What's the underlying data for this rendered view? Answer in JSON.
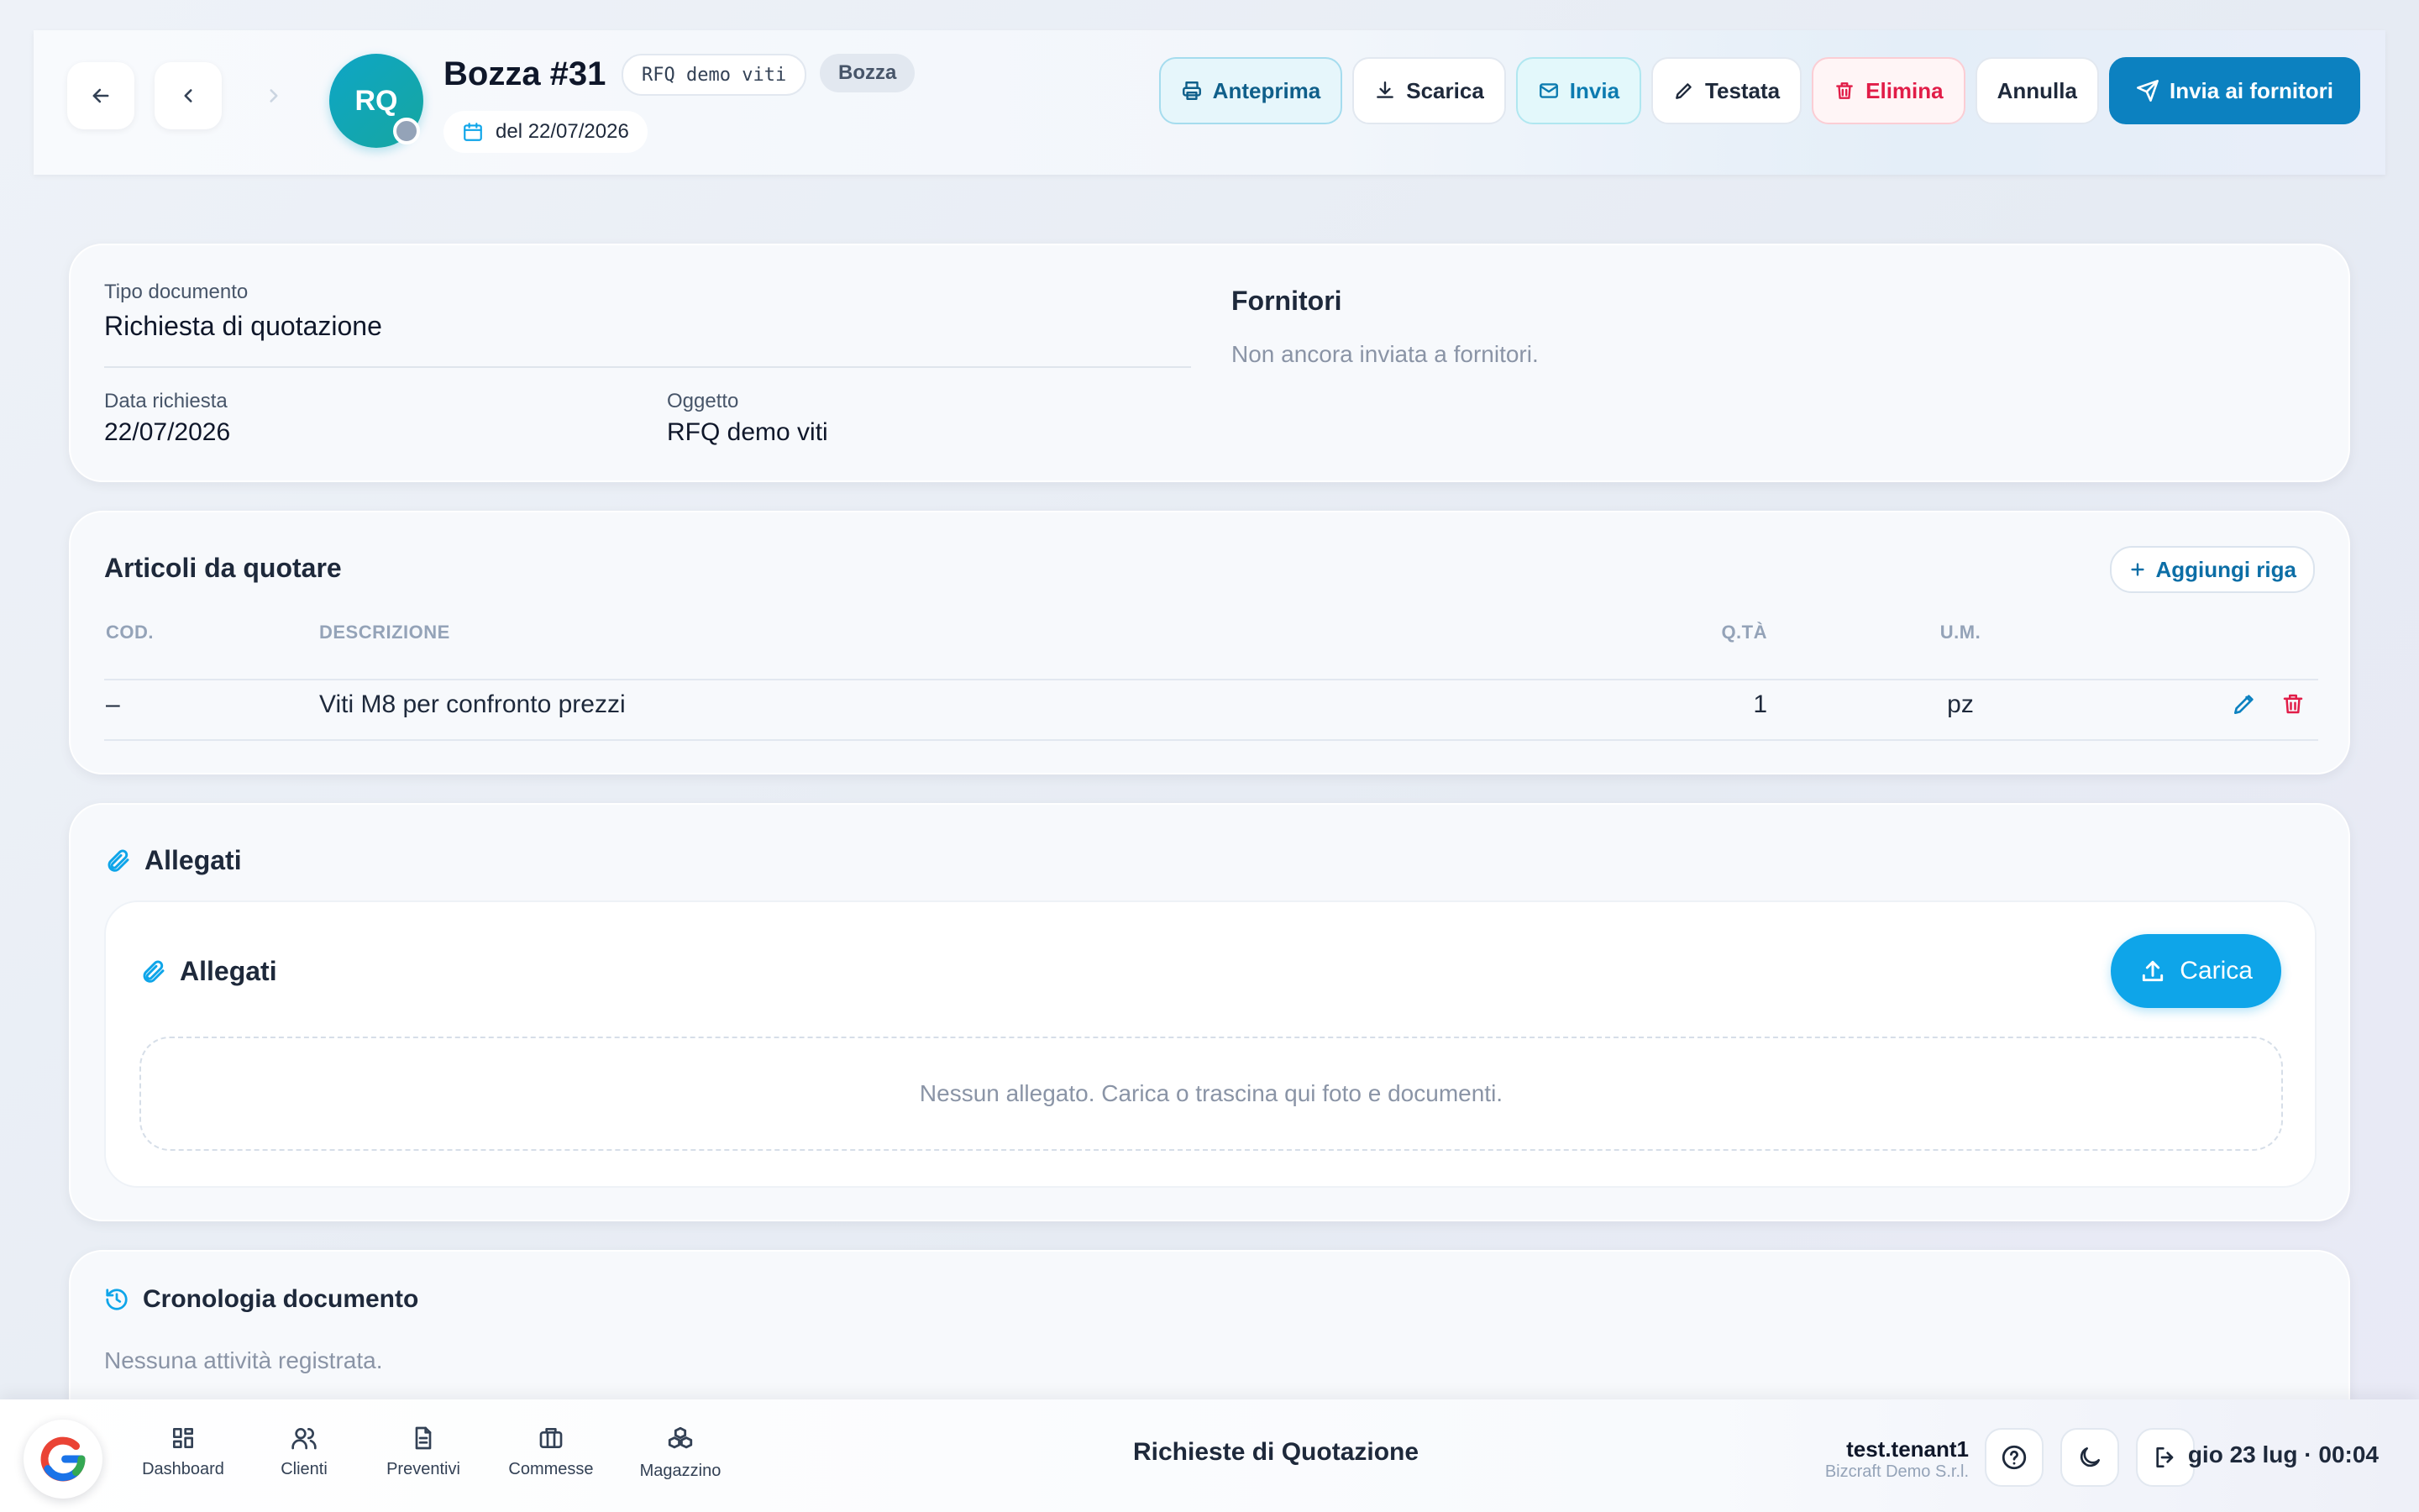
{
  "header": {
    "avatar_initials": "RQ",
    "title": "Bozza #31",
    "code_tag": "RFQ demo viti",
    "status_tag": "Bozza",
    "date_label": "del 22/07/2026",
    "actions": {
      "preview": "Anteprima",
      "download": "Scarica",
      "send": "Invia",
      "header": "Testata",
      "delete": "Elimina",
      "cancel": "Annulla",
      "send_suppliers": "Invia ai fornitori"
    }
  },
  "details": {
    "doc_type_label": "Tipo documento",
    "doc_type_value": "Richiesta di quotazione",
    "request_date_label": "Data richiesta",
    "request_date_value": "22/07/2026",
    "subject_label": "Oggetto",
    "subject_value": "RFQ demo viti",
    "suppliers_title": "Fornitori",
    "suppliers_empty": "Non ancora inviata a fornitori."
  },
  "items": {
    "title": "Articoli da quotare",
    "add_row": "Aggiungi riga",
    "columns": {
      "code": "COD.",
      "description": "DESCRIZIONE",
      "qty": "Q.TÀ",
      "unit": "U.M."
    },
    "rows": [
      {
        "code": "–",
        "description": "Viti M8 per confronto prezzi",
        "qty": "1",
        "unit": "pz"
      }
    ]
  },
  "attachments": {
    "section_title": "Allegati",
    "panel_title": "Allegati",
    "upload": "Carica",
    "empty": "Nessun allegato. Carica o trascina qui foto e documenti."
  },
  "history": {
    "title": "Cronologia documento",
    "empty": "Nessuna attività registrata."
  },
  "bottom_bar": {
    "nav": [
      {
        "label": "Dashboard",
        "icon": "dashboard-icon"
      },
      {
        "label": "Clienti",
        "icon": "users-icon"
      },
      {
        "label": "Preventivi",
        "icon": "document-icon"
      },
      {
        "label": "Commesse",
        "icon": "briefcase-icon"
      },
      {
        "label": "Magazzino",
        "icon": "boxes-icon"
      }
    ],
    "page_title": "Richieste di Quotazione",
    "user_name": "test.tenant1",
    "org_name": "Bizcraft Demo S.r.l.",
    "clock": "gio 23 lug · 00:04"
  },
  "colors": {
    "primary": "#0c81c0",
    "accent": "#0ea5e9",
    "danger": "#e11d48",
    "muted_text": "#8a94a6"
  }
}
